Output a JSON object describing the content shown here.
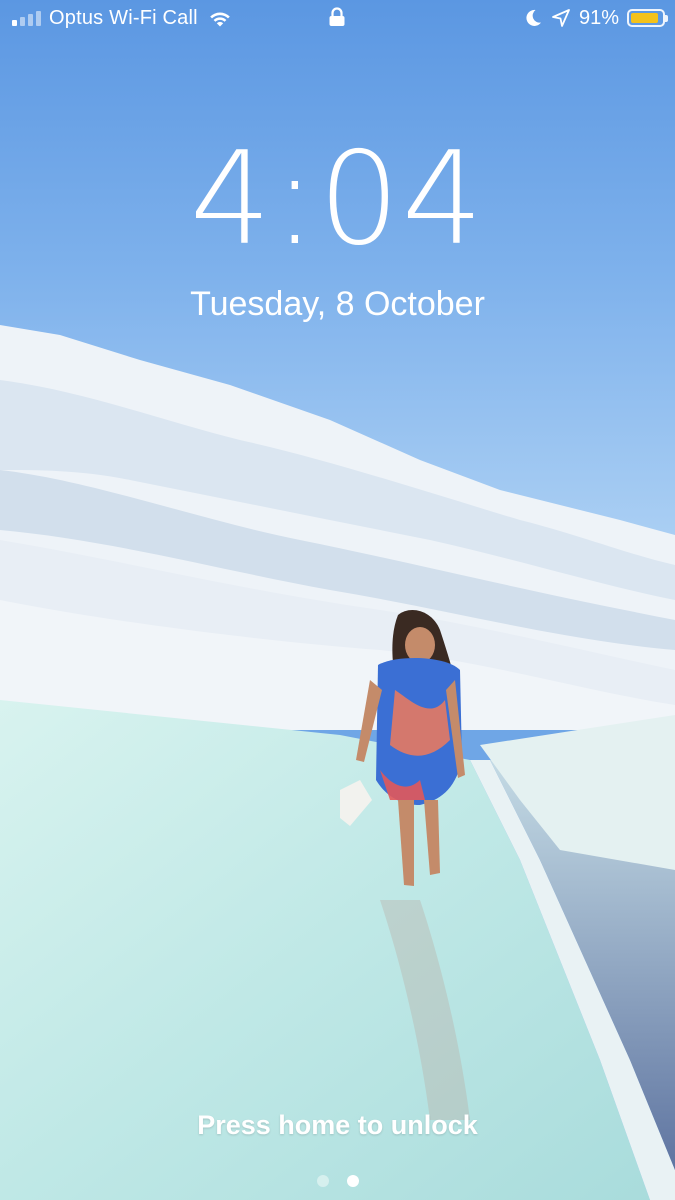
{
  "status_bar": {
    "carrier": "Optus Wi-Fi Call",
    "signal_bars_active": 1,
    "battery_percent": "91%",
    "battery_level": 0.91,
    "battery_color": "#f4c21a",
    "icons": [
      "wifi-icon",
      "lock-icon",
      "moon-icon",
      "location-arrow-icon"
    ]
  },
  "lock_screen": {
    "time": "4:04",
    "date": "Tuesday, 8 October",
    "unlock_hint": "Press home to unlock",
    "page_count": 2,
    "active_page": 1
  },
  "colors": {
    "sky_top": "#5f9ae3",
    "sky_bottom": "#a9cdf2",
    "water": "#c9ecea"
  }
}
